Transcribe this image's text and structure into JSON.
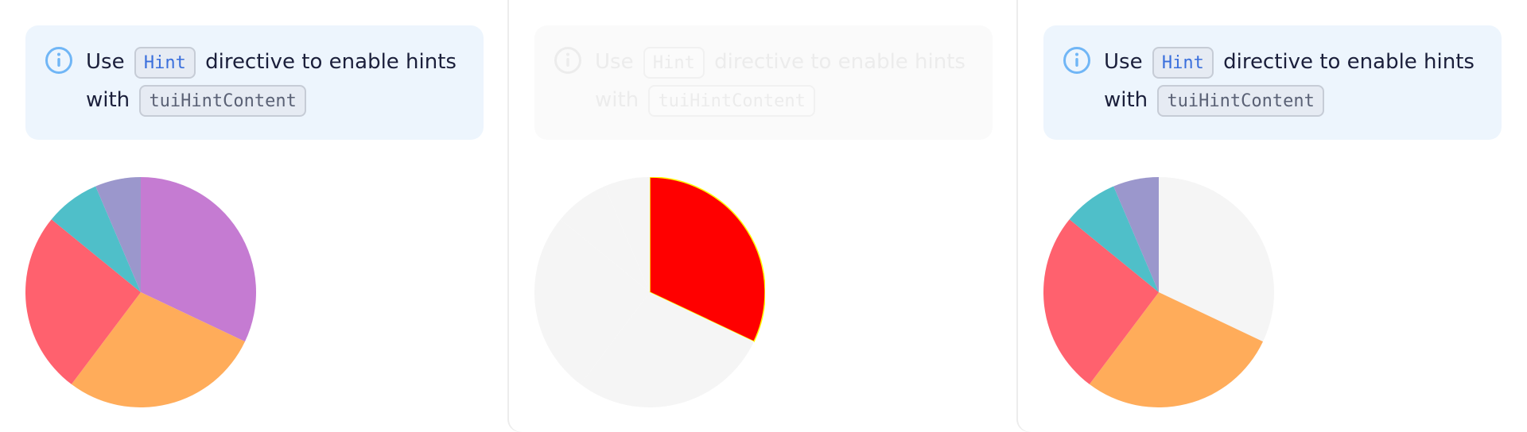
{
  "hint": {
    "word_use": "Use",
    "chip_hint": "Hint",
    "rest_line1": "directive to enable hints",
    "word_with": "with",
    "chip_content": "tuiHintContent"
  },
  "colors": {
    "notification_bg": "#edf5fd",
    "info_icon": "#70b6f6",
    "slice_colors": [
      "#c57bd2",
      "#ffac5a",
      "#ff616e",
      "#4fbfc9",
      "#9b97cc"
    ],
    "inactive_slice": "#f5f5f5",
    "active_red": "#ff0000",
    "active_outline": "#ffff00"
  },
  "chart_data": [
    {
      "type": "pie",
      "label": "left",
      "values": [
        125,
        110,
        100,
        30,
        25
      ],
      "active": null
    },
    {
      "type": "pie",
      "label": "center",
      "values": [
        125,
        110,
        100,
        30,
        25
      ],
      "active": 0
    },
    {
      "type": "pie",
      "label": "right",
      "values": [
        125,
        110,
        100,
        30,
        25
      ],
      "active": null,
      "dimmed": [
        0
      ]
    }
  ]
}
